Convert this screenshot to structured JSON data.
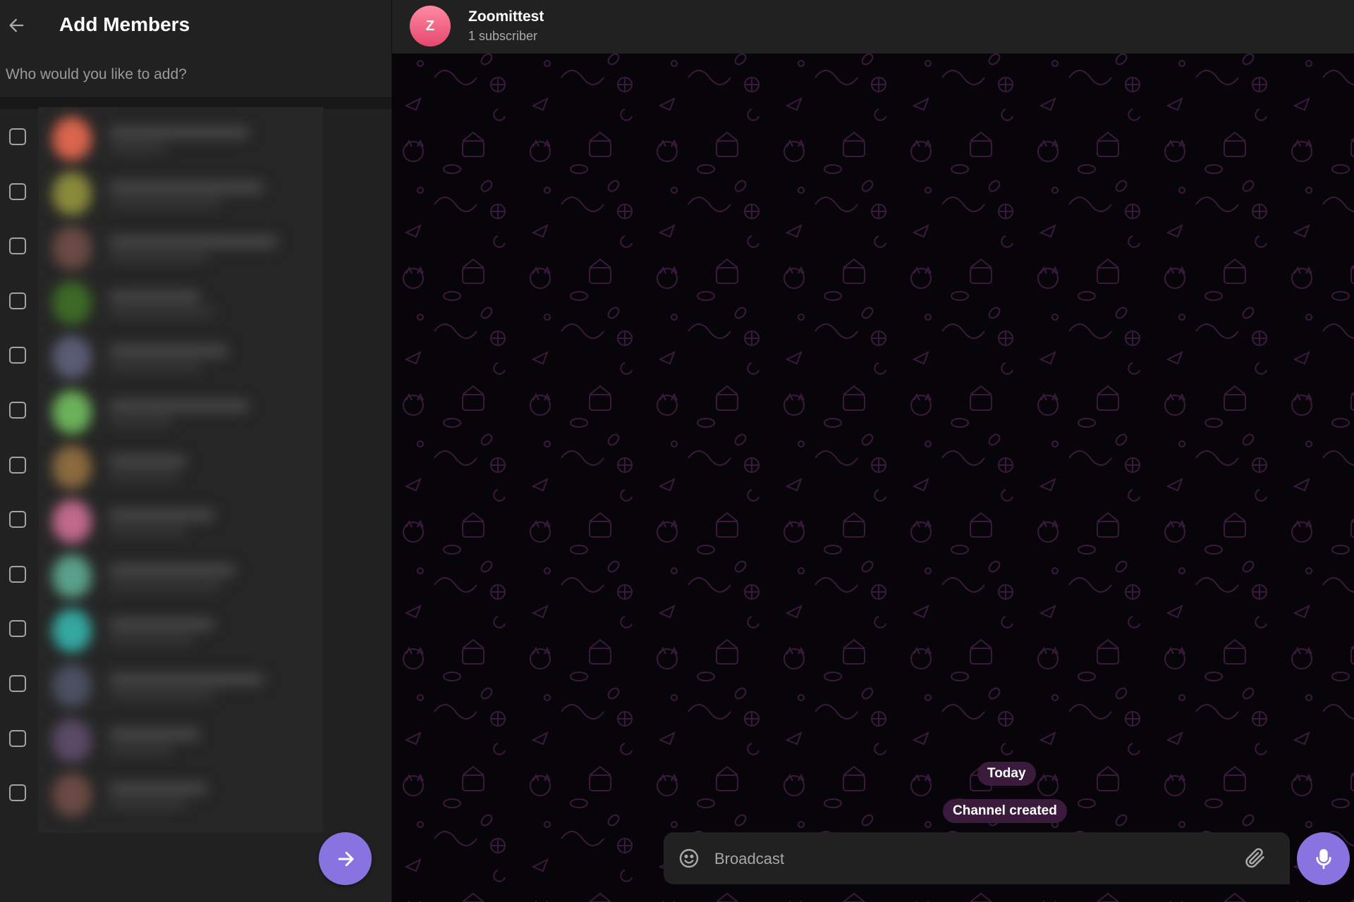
{
  "left_panel": {
    "title": "Add Members",
    "search_placeholder": "Who would you like to add?",
    "contacts": [
      {
        "checked": false,
        "avatar_color": "#d9654c"
      },
      {
        "checked": false,
        "avatar_color": "#8a8a3c"
      },
      {
        "checked": false,
        "avatar_color": "#6a4a44"
      },
      {
        "checked": false,
        "avatar_color": "#3d6a26"
      },
      {
        "checked": false,
        "avatar_color": "#5a5c74"
      },
      {
        "checked": false,
        "avatar_color": "#6bb25a"
      },
      {
        "checked": false,
        "avatar_color": "#8a6a3e"
      },
      {
        "checked": false,
        "avatar_color": "#c06a8a"
      },
      {
        "checked": false,
        "avatar_color": "#5aa08a"
      },
      {
        "checked": false,
        "avatar_color": "#35a8a0"
      },
      {
        "checked": false,
        "avatar_color": "#4a5060"
      },
      {
        "checked": false,
        "avatar_color": "#5a4a66"
      },
      {
        "checked": false,
        "avatar_color": "#6a4a44"
      }
    ],
    "next_icon": "arrow-right-icon"
  },
  "chat": {
    "avatar_letter": "Z",
    "title": "Zoomittest",
    "subtitle": "1 subscriber",
    "date_separator": "Today",
    "service_message": "Channel created",
    "composer_placeholder": "Broadcast",
    "icons": {
      "emoji": "smile-icon",
      "attach": "paperclip-icon",
      "send": "microphone-icon"
    }
  },
  "colors": {
    "accent": "#8774e1",
    "panel_bg": "#212121",
    "avatar_gradient_top": "#ff8aa1",
    "avatar_gradient_bottom": "#e5486d",
    "service_pill": "#3a1b3c"
  }
}
